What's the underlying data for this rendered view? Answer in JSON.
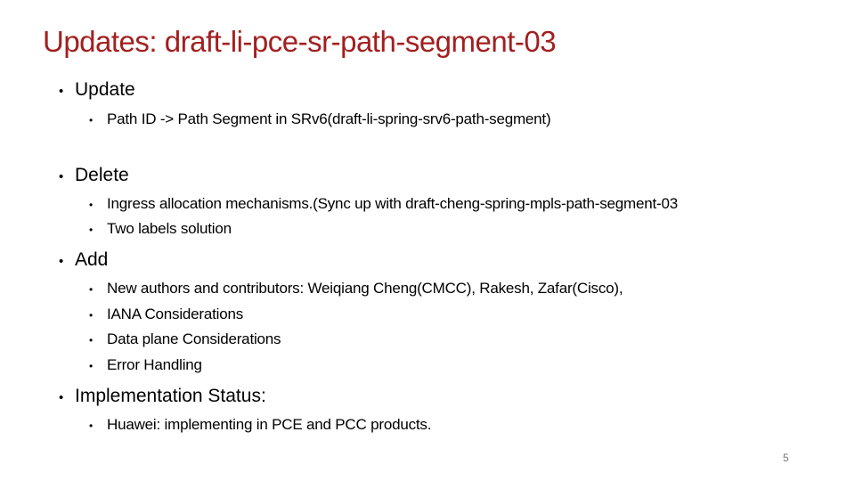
{
  "slide": {
    "title": "Updates: draft-li-pce-sr-path-segment-03",
    "title_color": "#a31f1f",
    "bullet_glyph": "•",
    "sections": [
      {
        "heading": "Update",
        "items": [
          "Path ID -> Path Segment in SRv6(draft-li-spring-srv6-path-segment)"
        ]
      },
      {
        "heading": "Delete",
        "items": [
          "Ingress allocation mechanisms.(Sync up with draft-cheng-spring-mpls-path-segment-03",
          "Two labels solution"
        ]
      },
      {
        "heading": "Add",
        "items": [
          "New authors and contributors: Weiqiang Cheng(CMCC), Rakesh, Zafar(Cisco),",
          "IANA Considerations",
          "Data plane Considerations",
          "Error Handling"
        ]
      },
      {
        "heading": "Implementation Status:",
        "items": [
          "Huawei: implementing in PCE and PCC products."
        ]
      }
    ],
    "page_number": "5"
  }
}
